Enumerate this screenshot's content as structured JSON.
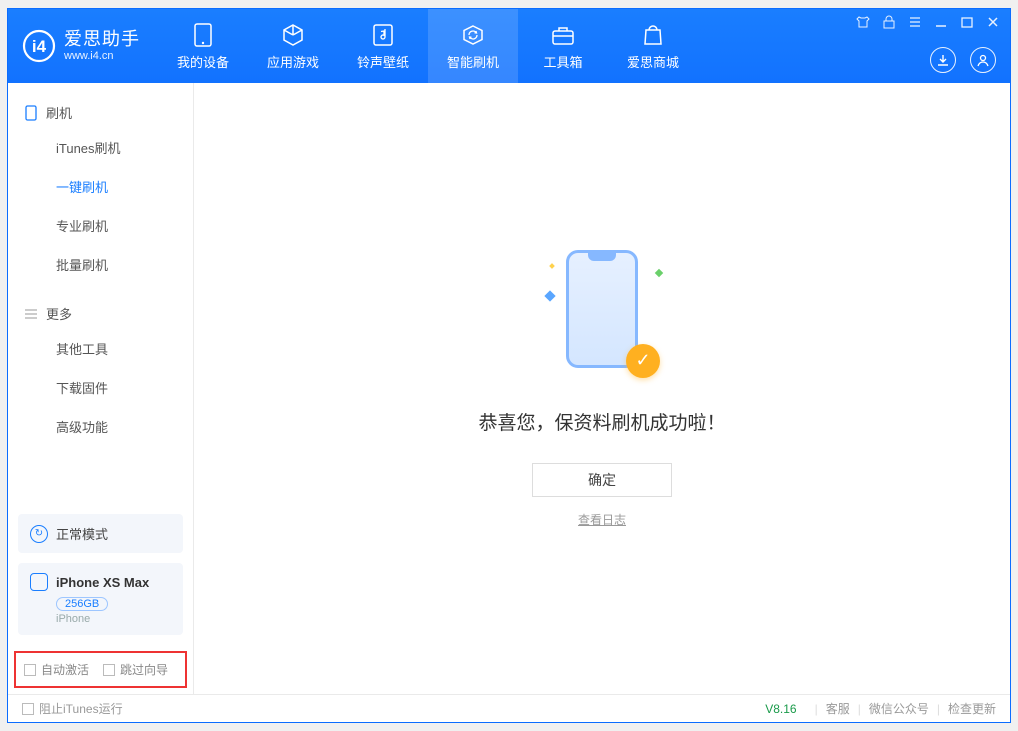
{
  "app": {
    "name": "爱思助手",
    "url": "www.i4.cn"
  },
  "nav": {
    "tabs": [
      {
        "label": "我的设备",
        "icon": "device"
      },
      {
        "label": "应用游戏",
        "icon": "cube"
      },
      {
        "label": "铃声壁纸",
        "icon": "music"
      },
      {
        "label": "智能刷机",
        "icon": "refresh"
      },
      {
        "label": "工具箱",
        "icon": "toolbox"
      },
      {
        "label": "爱思商城",
        "icon": "bag"
      }
    ],
    "active_index": 3
  },
  "sidebar": {
    "sections": [
      {
        "title": "刷机",
        "items": [
          "iTunes刷机",
          "一键刷机",
          "专业刷机",
          "批量刷机"
        ],
        "active_index": 1
      },
      {
        "title": "更多",
        "items": [
          "其他工具",
          "下载固件",
          "高级功能"
        ],
        "active_index": -1
      }
    ],
    "mode": "正常模式",
    "device": {
      "name": "iPhone XS Max",
      "capacity": "256GB",
      "type": "iPhone"
    },
    "red_box": {
      "auto_activate": "自动激活",
      "skip_guide": "跳过向导"
    }
  },
  "main": {
    "success_text": "恭喜您，保资料刷机成功啦！",
    "ok_button": "确定",
    "log_link": "查看日志"
  },
  "footer": {
    "stop_itunes": "阻止iTunes运行",
    "version": "V8.16",
    "links": [
      "客服",
      "微信公众号",
      "检查更新"
    ]
  }
}
